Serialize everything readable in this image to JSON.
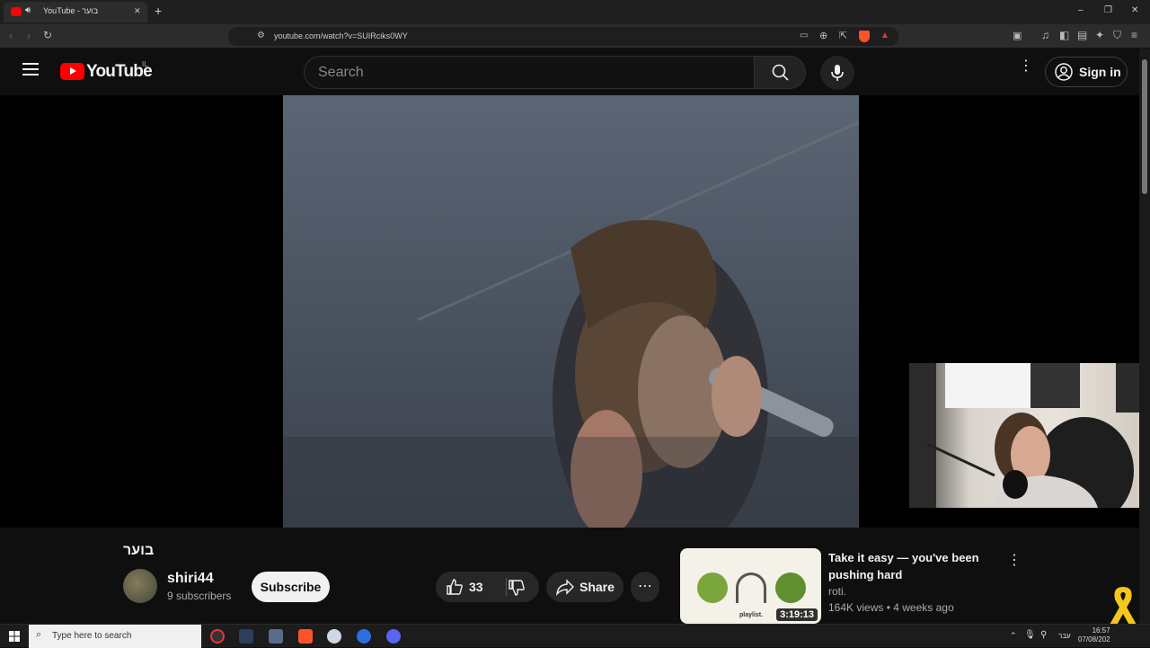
{
  "browser": {
    "tab_title": "YouTube - בוער",
    "tab_close": "✕",
    "new_tab": "+",
    "url": "youtube.com/watch?v=SUIRciks0WY",
    "window_controls": [
      "–",
      "❐",
      "✕"
    ]
  },
  "header": {
    "logo_text": "YouTube",
    "region": "IL",
    "search_placeholder": "Search",
    "sign_in": "Sign in"
  },
  "video": {
    "title": "בוער",
    "channel": "shiri44",
    "subscribers": "9 subscribers",
    "subscribe": "Subscribe",
    "likes": "33",
    "share": "Share"
  },
  "recommended": {
    "title": "Take it easy — you've been pushing hard",
    "channel": "roti.",
    "meta": "164K views • 4 weeks ago",
    "duration": "3:19:13",
    "thumb_caption": "playlist."
  },
  "taskbar": {
    "search_label": "Type here to search",
    "lang": "עבר",
    "time": "16:57",
    "date": "07/08/202"
  },
  "colors": {
    "youtube_red": "#ff0000",
    "background": "#0f0f0f",
    "pill": "#272727"
  }
}
